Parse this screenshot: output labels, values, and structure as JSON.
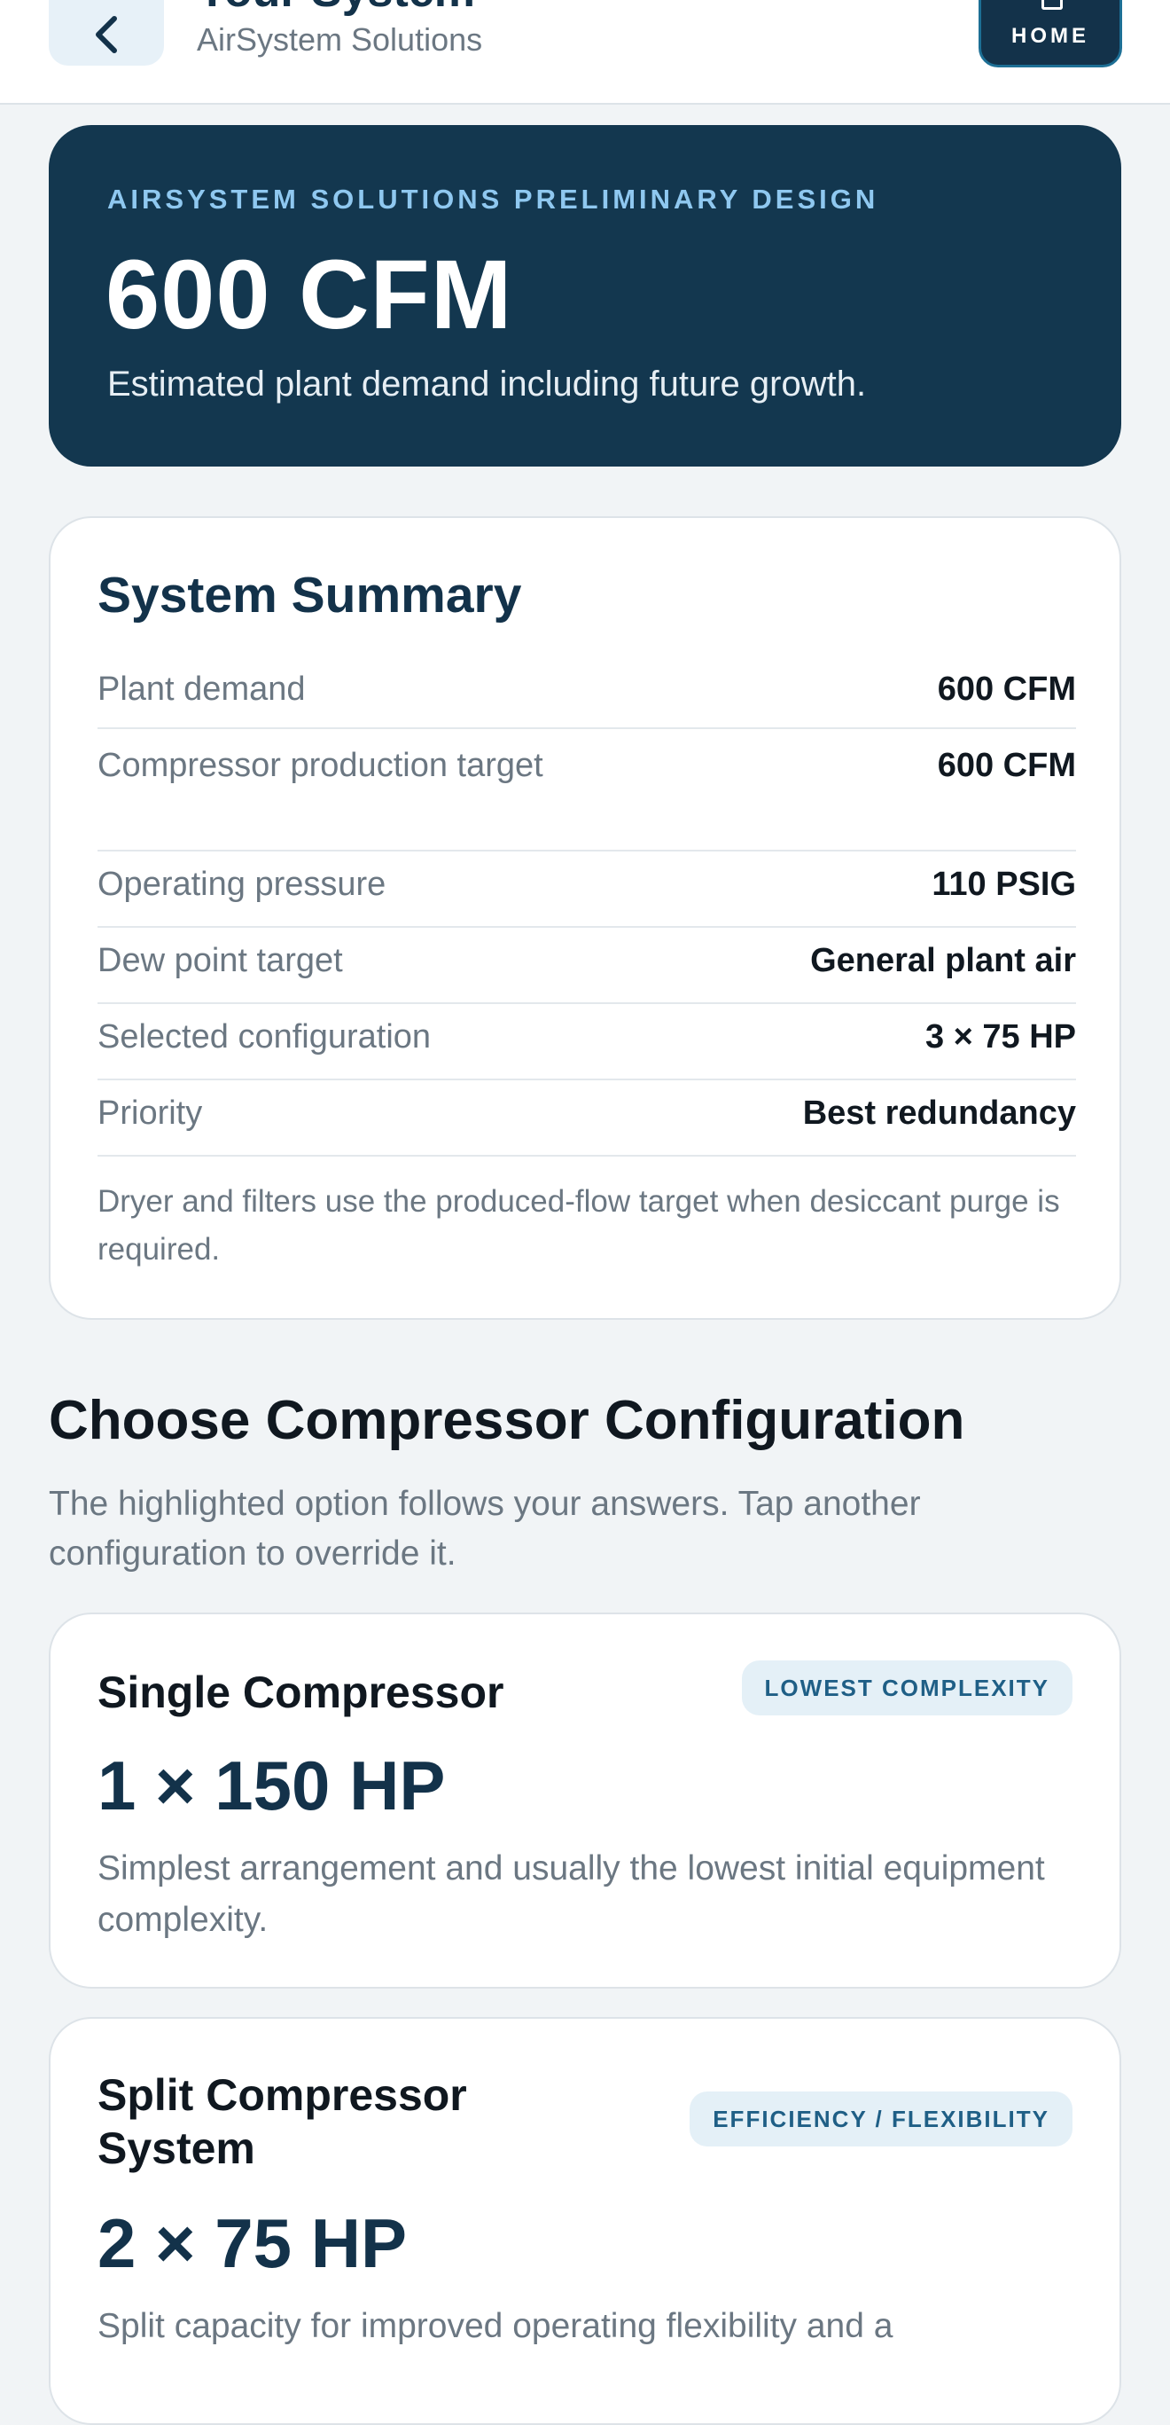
{
  "header": {
    "title": "Your System",
    "subtitle": "AirSystem Solutions",
    "home_label": "HOME"
  },
  "hero": {
    "eyebrow": "AIRSYSTEM SOLUTIONS PRELIMINARY DESIGN",
    "value": "600 CFM",
    "description": "Estimated plant demand including future growth."
  },
  "summary": {
    "title": "System Summary",
    "rows": [
      {
        "label": "Plant demand",
        "value": "600 CFM"
      },
      {
        "label": "Compressor production target",
        "value": "600 CFM"
      },
      {
        "label": "Operating pressure",
        "value": "110 PSIG"
      },
      {
        "label": "Dew point target",
        "value": "General plant air"
      },
      {
        "label": "Selected configuration",
        "value": "3 × 75 HP"
      },
      {
        "label": "Priority",
        "value": "Best redundancy"
      }
    ],
    "note": "Dryer and filters use the produced-flow target when desiccant purge is required."
  },
  "configuration": {
    "title": "Choose Compressor Configuration",
    "description": "The highlighted option follows your answers. Tap another configuration to override it.",
    "options": [
      {
        "name": "Single Compressor",
        "badge": "LOWEST COMPLEXITY",
        "hp": "1 × 150 HP",
        "description": "Simplest arrangement and usually the lowest initial equipment complexity."
      },
      {
        "name": "Split Compressor System",
        "badge": "EFFICIENCY / FLEXIBILITY",
        "hp": "2 × 75 HP",
        "description": "Split capacity for improved operating flexibility and a"
      }
    ]
  },
  "icons": {
    "back": "chevron-left-icon",
    "home": "home-icon"
  },
  "colors": {
    "navy": "#13374f",
    "accent_light": "#8fc8f0",
    "badge_bg": "#e4f0f7",
    "badge_text": "#1f5f86",
    "page_bg": "#f1f4f6"
  }
}
